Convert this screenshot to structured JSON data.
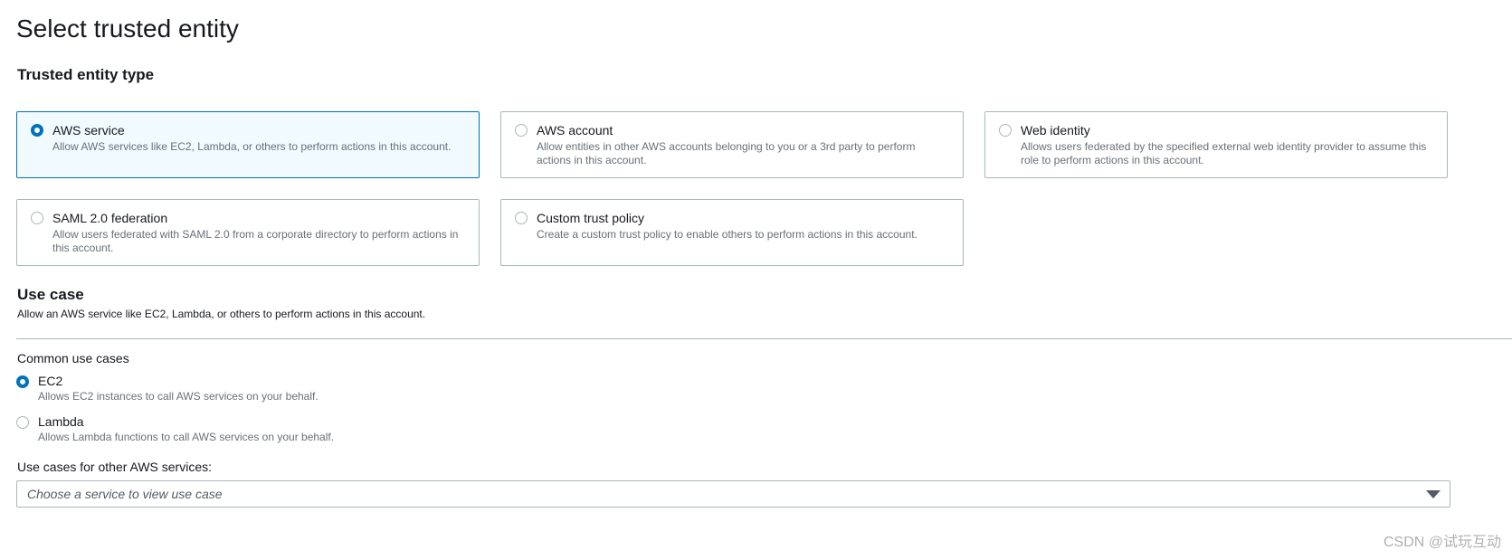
{
  "page": {
    "title": "Select trusted entity"
  },
  "trusted_entity": {
    "heading": "Trusted entity type",
    "options": [
      {
        "label": "AWS service",
        "description": "Allow AWS services like EC2, Lambda, or others to perform actions in this account.",
        "selected": true
      },
      {
        "label": "AWS account",
        "description": "Allow entities in other AWS accounts belonging to you or a 3rd party to perform actions in this account.",
        "selected": false
      },
      {
        "label": "Web identity",
        "description": "Allows users federated by the specified external web identity provider to assume this role to perform actions in this account.",
        "selected": false
      },
      {
        "label": "SAML 2.0 federation",
        "description": "Allow users federated with SAML 2.0 from a corporate directory to perform actions in this account.",
        "selected": false
      },
      {
        "label": "Custom trust policy",
        "description": "Create a custom trust policy to enable others to perform actions in this account.",
        "selected": false
      }
    ]
  },
  "use_case": {
    "heading": "Use case",
    "description": "Allow an AWS service like EC2, Lambda, or others to perform actions in this account.",
    "common_label": "Common use cases",
    "options": [
      {
        "label": "EC2",
        "description": "Allows EC2 instances to call AWS services on your behalf.",
        "selected": true
      },
      {
        "label": "Lambda",
        "description": "Allows Lambda functions to call AWS services on your behalf.",
        "selected": false
      }
    ],
    "other_label": "Use cases for other AWS services:",
    "select_placeholder": "Choose a service to view use case"
  },
  "watermark": "CSDN @试玩互动",
  "colors": {
    "accent": "#0073bb",
    "selected_tile_bg": "#f1faff",
    "border": "#aab7b8",
    "muted_text": "#687078"
  }
}
